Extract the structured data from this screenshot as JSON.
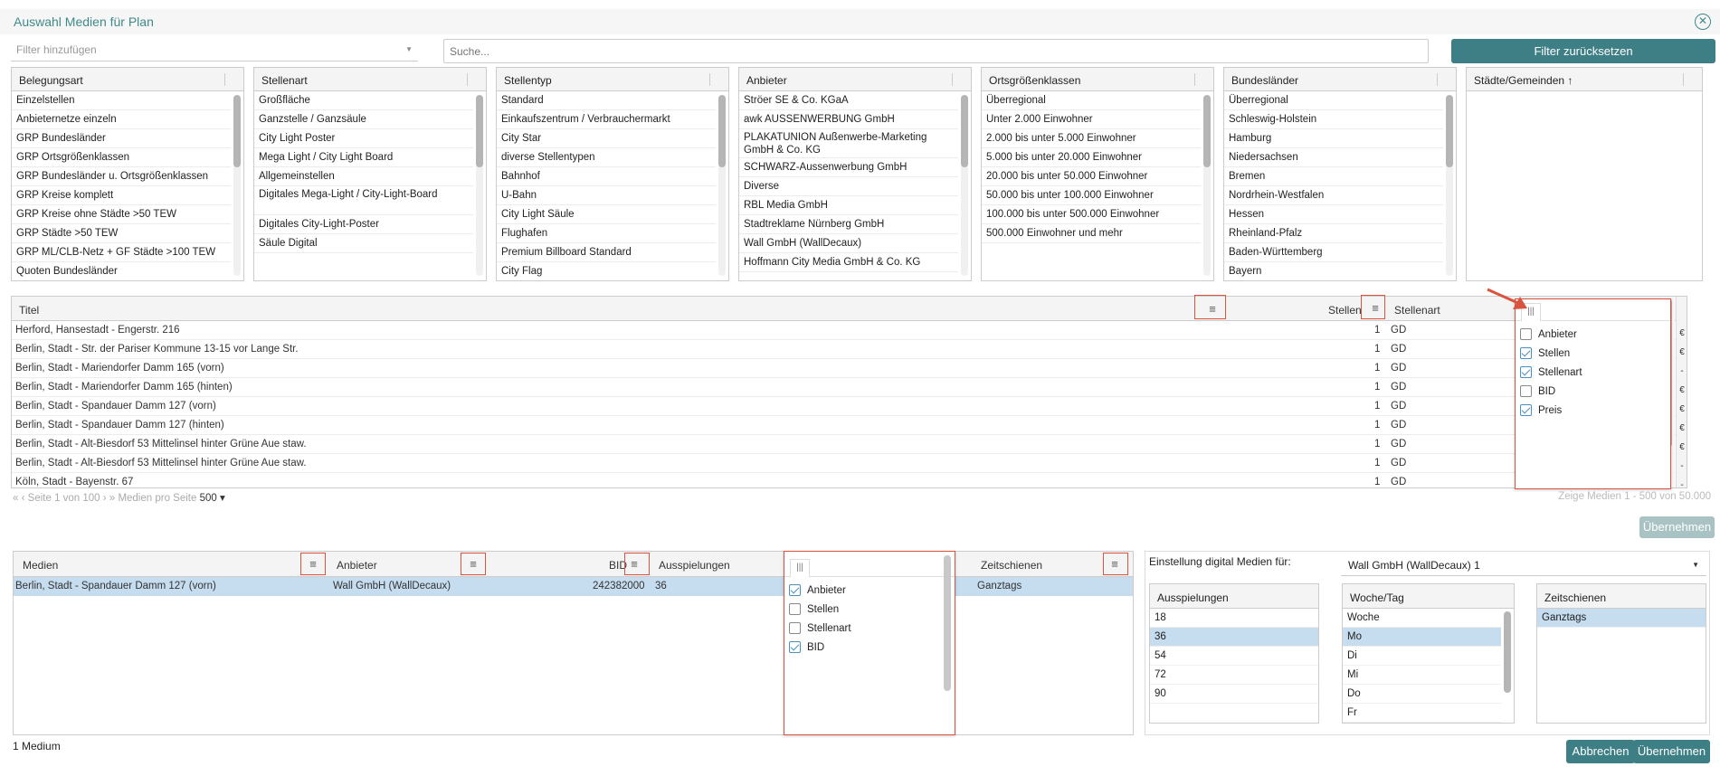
{
  "dialog": {
    "title": "Auswahl Medien für Plan"
  },
  "filters": {
    "add_placeholder": "Filter hinzufügen",
    "search_placeholder": "Suche...",
    "reset_label": "Filter zurücksetzen"
  },
  "panels": [
    {
      "title": "Belegungsart",
      "items": [
        "Einzelstellen",
        "Anbieternetze einzeln",
        "GRP Bundesländer",
        "GRP Ortsgrößenklassen",
        "GRP Bundesländer u. Ortsgrößenklassen",
        "GRP Kreise komplett",
        "GRP Kreise ohne Städte >50 TEW",
        "GRP Städte >50 TEW",
        "GRP ML/CLB-Netz + GF Städte >100 TEW",
        "Quoten Bundesländer"
      ]
    },
    {
      "title": "Stellenart",
      "items": [
        "Großfläche",
        "Ganzstelle / Ganzsäule",
        "City Light Poster",
        "Mega Light / City Light Board",
        "Allgemeinstellen",
        "Digitales Mega-Light / City-Light-Board",
        "Digitales City-Light-Poster",
        "Säule Digital"
      ]
    },
    {
      "title": "Stellentyp",
      "items": [
        "Standard",
        "Einkaufszentrum / Verbrauchermarkt",
        "City Star",
        "diverse Stellentypen",
        "Bahnhof",
        "U-Bahn",
        "City Light Säule",
        "Flughafen",
        "Premium Billboard Standard",
        "City Flag"
      ]
    },
    {
      "title": "Anbieter",
      "items": [
        "Ströer SE & Co. KGaA",
        "awk AUSSENWERBUNG GmbH",
        "PLAKATUNION Außenwerbe-Marketing GmbH & Co. KG",
        "SCHWARZ-Aussenwerbung GmbH",
        "Diverse",
        "RBL Media GmbH",
        "Stadtreklame Nürnberg GmbH",
        "Wall GmbH (WallDecaux)",
        "Hoffmann City Media GmbH & Co. KG"
      ]
    },
    {
      "title": "Ortsgrößenklassen",
      "items": [
        "Überregional",
        "Unter 2.000 Einwohner",
        "2.000 bis unter 5.000 Einwohner",
        "5.000 bis unter 20.000 Einwohner",
        "20.000 bis unter 50.000 Einwohner",
        "50.000 bis unter 100.000 Einwohner",
        "100.000 bis unter 500.000 Einwohner",
        "500.000 Einwohner und mehr"
      ]
    },
    {
      "title": "Bundesländer",
      "items": [
        "Überregional",
        "Schleswig-Holstein",
        "Hamburg",
        "Niedersachsen",
        "Bremen",
        "Nordrhein-Westfalen",
        "Hessen",
        "Rheinland-Pfalz",
        "Baden-Württemberg",
        "Bayern"
      ]
    },
    {
      "title": "Städte/Gemeinden",
      "sort_icon": "arrow-up-icon",
      "items": []
    }
  ],
  "media_grid": {
    "headers": {
      "titel": "Titel",
      "stellen": "Stellen",
      "stellenart": "Stellenart"
    },
    "rows": [
      {
        "titel": "Herford, Hansestadt - Engerstr. 216",
        "stellen": "1",
        "stellenart": "GD"
      },
      {
        "titel": "Berlin, Stadt - Str. der Pariser Kommune 13-15 vor Lange Str.",
        "stellen": "1",
        "stellenart": "GD"
      },
      {
        "titel": "Berlin, Stadt - Mariendorfer Damm 165 (vorn)",
        "stellen": "1",
        "stellenart": "GD"
      },
      {
        "titel": "Berlin, Stadt - Mariendorfer Damm 165 (hinten)",
        "stellen": "1",
        "stellenart": "GD"
      },
      {
        "titel": "Berlin, Stadt - Spandauer Damm 127 (vorn)",
        "stellen": "1",
        "stellenart": "GD"
      },
      {
        "titel": "Berlin, Stadt - Spandauer Damm 127 (hinten)",
        "stellen": "1",
        "stellenart": "GD"
      },
      {
        "titel": "Berlin, Stadt - Alt-Biesdorf 53 Mittelinsel hinter Grüne Aue staw.",
        "stellen": "1",
        "stellenart": "GD"
      },
      {
        "titel": "Berlin, Stadt - Alt-Biesdorf 53 Mittelinsel hinter Grüne Aue staw.",
        "stellen": "1",
        "stellenart": "GD"
      },
      {
        "titel": "Köln, Stadt - Bayenstr. 67",
        "stellen": "1",
        "stellenart": "GD"
      }
    ],
    "edge_marks": [
      "€",
      "€",
      "-",
      "€",
      "€",
      "€",
      "€",
      "-",
      "-",
      "€"
    ],
    "column_chooser": [
      {
        "label": "Anbieter",
        "checked": false
      },
      {
        "label": "Stellen",
        "checked": true
      },
      {
        "label": "Stellenart",
        "checked": true
      },
      {
        "label": "BID",
        "checked": false
      },
      {
        "label": "Preis",
        "checked": true
      }
    ],
    "chooser_tab_icon": "columns-icon"
  },
  "pager": {
    "page_label": "Seite 1 von 100",
    "per_page_label": "Medien pro Seite",
    "per_page_value": "500",
    "info": "Zeige Medien 1 - 500 von 50.000"
  },
  "uebernehmen_label": "Übernehmen",
  "selected_grid": {
    "headers": {
      "medien": "Medien",
      "anbieter": "Anbieter",
      "bid": "BID",
      "ausspielungen": "Ausspielungen",
      "zeitschienen": "Zeitschienen"
    },
    "row": {
      "medien": "Berlin, Stadt - Spandauer Damm 127 (vorn)",
      "anbieter": "Wall GmbH (WallDecaux)",
      "bid": "242382000",
      "ausspielungen": "36",
      "zeitschienen": "Ganztags"
    },
    "column_chooser": [
      {
        "label": "Anbieter",
        "checked": true
      },
      {
        "label": "Stellen",
        "checked": false
      },
      {
        "label": "Stellenart",
        "checked": false
      },
      {
        "label": "BID",
        "checked": true
      }
    ],
    "count_label": "1 Medium"
  },
  "digital": {
    "label": "Einstellung digital Medien für:",
    "selected": "Wall GmbH (WallDecaux) 1",
    "ausspielungen": {
      "title": "Ausspielungen",
      "items": [
        "18",
        "36",
        "54",
        "72",
        "90"
      ],
      "selected": "36"
    },
    "woche_tag": {
      "title": "Woche/Tag",
      "items": [
        "Woche",
        "Mo",
        "Di",
        "Mi",
        "Do",
        "Fr"
      ],
      "selected": "Mo"
    },
    "zeitschienen": {
      "title": "Zeitschienen",
      "items": [
        "Ganztags"
      ],
      "selected": "Ganztags"
    }
  },
  "footer": {
    "cancel_label": "Abbrechen",
    "apply_label": "Übernehmen"
  },
  "colors": {
    "accent": "#3e7e85",
    "highlight": "#d9533f",
    "selection": "#c6dcef"
  }
}
